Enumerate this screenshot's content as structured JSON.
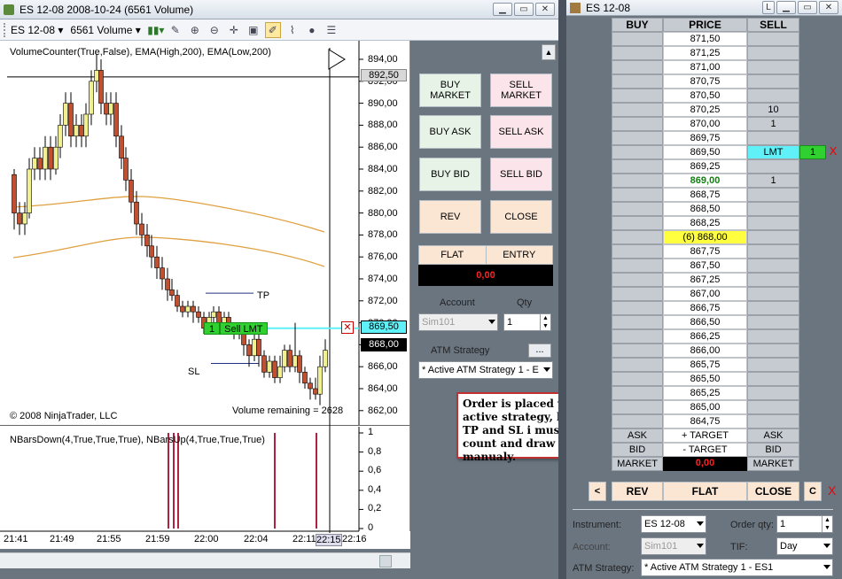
{
  "chart_window": {
    "title": "ES 12-08   2008-10-24  (6561 Volume)",
    "instrument": "ES 12-08",
    "period": "6561 Volume",
    "indicator_label": "VolumeCounter(True,False), EMA(High,200), EMA(Low,200)",
    "copyright": "© 2008 NinjaTrader, LLC",
    "volume_remaining": "Volume remaining = 2628",
    "lower_label": "NBarsDown(4,True,True,True), NBarsUp(4,True,True,True)",
    "price_ticks": [
      "894,00",
      "892,00",
      "890,00",
      "888,00",
      "886,00",
      "884,00",
      "882,00",
      "880,00",
      "878,00",
      "876,00",
      "874,00",
      "872,00",
      "870,00",
      "868,00",
      "866,00",
      "864,00",
      "862,00"
    ],
    "price_tag_gray": "892,50",
    "price_tag_cyan": "869,50",
    "price_tag_black": "868,00",
    "lower_ticks": [
      "1",
      "0,8",
      "0,6",
      "0,4",
      "0,2",
      "0"
    ],
    "time_ticks": [
      "21:41",
      "21:49",
      "21:55",
      "21:59",
      "22:00",
      "22:04",
      "22:11",
      "22:15",
      "22:16"
    ],
    "tp_label": "TP",
    "sl_label": "SL",
    "order_qty": "1",
    "order_label": "Sell LMT",
    "close_x": "✕"
  },
  "order_panel": {
    "buy_market": "BUY\nMARKET",
    "sell_market": "SELL\nMARKET",
    "buy_ask": "BUY ASK",
    "sell_ask": "SELL ASK",
    "buy_bid": "BUY BID",
    "sell_bid": "SELL BID",
    "rev": "REV",
    "close": "CLOSE",
    "flat": "FLAT",
    "entry": "ENTRY",
    "pnl": "0,00",
    "account_label": "Account",
    "qty_label": "Qty",
    "account_value": "Sim101",
    "qty_value": "1",
    "atm_label": "ATM Strategy",
    "atm_btn": "...",
    "atm_value": "* Active ATM Strategy 1 - E"
  },
  "callout": "Order is placed with active strategy, but my TP and SL i must count and draw manualy.",
  "dom": {
    "title": "ES 12-08",
    "headers": [
      "BUY",
      "PRICE",
      "SELL"
    ],
    "rows": [
      {
        "price": "871,50",
        "sell": ""
      },
      {
        "price": "871,25",
        "sell": ""
      },
      {
        "price": "871,00",
        "sell": ""
      },
      {
        "price": "870,75",
        "sell": ""
      },
      {
        "price": "870,50",
        "sell": ""
      },
      {
        "price": "870,25",
        "sell": "10"
      },
      {
        "price": "870,00",
        "sell": "1"
      },
      {
        "price": "869,75",
        "sell": ""
      },
      {
        "price": "869,50",
        "sell": "LMT",
        "extra": "1"
      },
      {
        "price": "869,25",
        "sell": ""
      },
      {
        "price": "869,00",
        "sell": "1",
        "bold": true
      },
      {
        "price": "868,75",
        "sell": ""
      },
      {
        "price": "868,50",
        "sell": ""
      },
      {
        "price": "868,25",
        "sell": ""
      },
      {
        "price": "(6) 868,00",
        "sell": "",
        "last": true
      },
      {
        "price": "867,75",
        "sell": ""
      },
      {
        "price": "867,50",
        "sell": ""
      },
      {
        "price": "867,25",
        "sell": ""
      },
      {
        "price": "867,00",
        "sell": ""
      },
      {
        "price": "866,75",
        "sell": ""
      },
      {
        "price": "866,50",
        "sell": ""
      },
      {
        "price": "866,25",
        "sell": ""
      },
      {
        "price": "866,00",
        "sell": ""
      },
      {
        "price": "865,75",
        "sell": ""
      },
      {
        "price": "865,50",
        "sell": ""
      },
      {
        "price": "865,25",
        "sell": ""
      },
      {
        "price": "865,00",
        "sell": ""
      },
      {
        "price": "864,75",
        "sell": ""
      }
    ],
    "ask": "ASK",
    "plus_target": "+ TARGET",
    "bid": "BID",
    "minus_target": "- TARGET",
    "market": "MARKET",
    "dom_pnl": "0,00",
    "prev": "<",
    "rev": "REV",
    "flat": "FLAT",
    "close": "CLOSE",
    "c": "C",
    "x": "X",
    "instrument_label": "Instrument:",
    "instrument_value": "ES 12-08",
    "order_qty_label": "Order qty:",
    "order_qty_value": "1",
    "account_label": "Account:",
    "account_value": "Sim101",
    "tif_label": "TIF:",
    "tif_value": "Day",
    "atm_label": "ATM Strategy:",
    "atm_value": "* Active ATM Strategy 1 - ES1"
  },
  "colors": {
    "cyan": "#60f0f8",
    "green": "#30d030",
    "red": "#cc0000",
    "yellow": "#ffff40",
    "bull": "#f0f090",
    "bear": "#c05030",
    "ema": "#e0a040",
    "bars": "#b02040"
  }
}
